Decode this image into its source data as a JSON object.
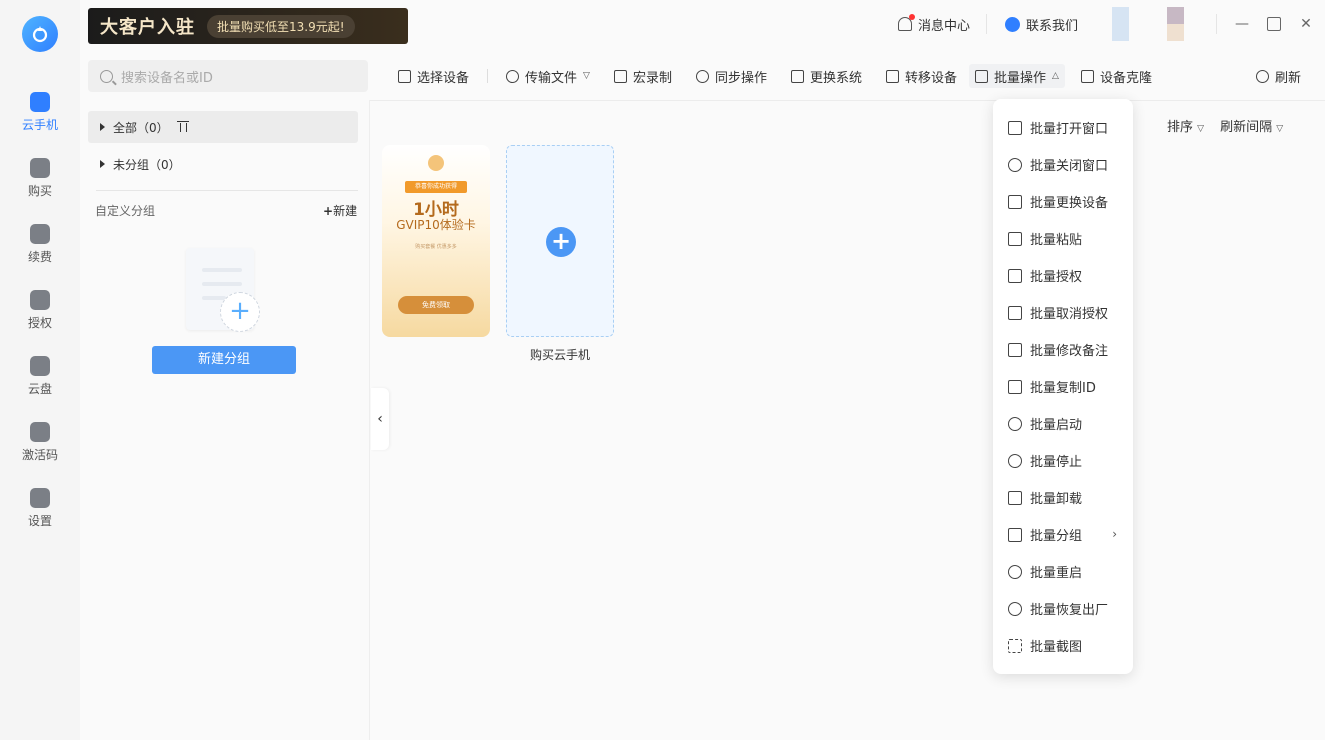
{
  "rail": {
    "items": [
      {
        "label": "云手机",
        "icon": "phone-icon"
      },
      {
        "label": "购买",
        "icon": "cart-icon"
      },
      {
        "label": "续费",
        "icon": "calendar-icon"
      },
      {
        "label": "授权",
        "icon": "shield-icon"
      },
      {
        "label": "云盘",
        "icon": "cloud-icon"
      },
      {
        "label": "激活码",
        "icon": "ticket-icon"
      },
      {
        "label": "设置",
        "icon": "gear-icon"
      }
    ]
  },
  "banner": {
    "title": "大客户入驻",
    "pill": "批量购买低至13.9元起!"
  },
  "header": {
    "messages": "消息中心",
    "contact": "联系我们",
    "swatches": [
      "#d6e4f3",
      "#c7b8c4",
      "#efe0d0"
    ]
  },
  "search": {
    "placeholder": "搜索设备名或ID"
  },
  "toolbar": {
    "items": [
      "选择设备",
      "传输文件",
      "宏录制",
      "同步操作",
      "更换系统",
      "转移设备",
      "批量操作",
      "设备克隆"
    ],
    "refresh": "刷新"
  },
  "groups": {
    "all": "全部（0）",
    "ungrouped": "未分组（0）",
    "custom_title": "自定义分组",
    "new_link": "新建",
    "new_group_button": "新建分组"
  },
  "filters": {
    "sort": "排序",
    "refresh_interval": "刷新间隔"
  },
  "promo": {
    "badge": "恭喜你成功获得",
    "big": "1小时",
    "sub": "GVIP10体验卡",
    "fine": "购买套餐 优惠多多",
    "button": "免费领取"
  },
  "add_card": {
    "label": "购买云手机"
  },
  "dropdown": {
    "items": [
      "批量打开窗口",
      "批量关闭窗口",
      "批量更换设备",
      "批量粘贴",
      "批量授权",
      "批量取消授权",
      "批量修改备注",
      "批量复制ID",
      "批量启动",
      "批量停止",
      "批量卸载",
      "批量分组",
      "批量重启",
      "批量恢复出厂",
      "批量截图"
    ]
  },
  "colors": {
    "accent": "#2f7fff",
    "button": "#4b97f5"
  }
}
